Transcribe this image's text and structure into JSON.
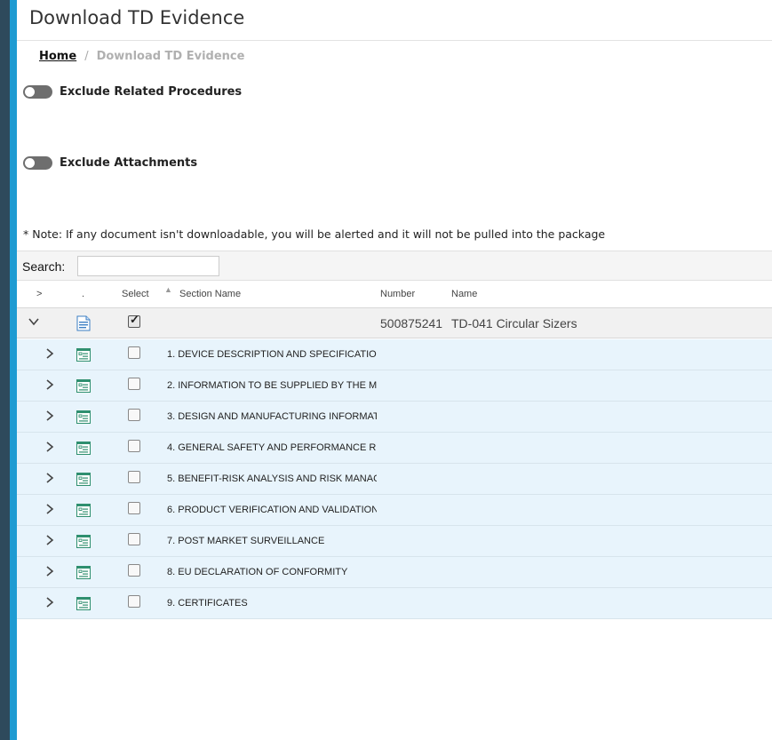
{
  "page": {
    "title": "Download TD Evidence"
  },
  "breadcrumb": {
    "home": "Home",
    "separator": "/",
    "current": "Download TD Evidence"
  },
  "toggles": [
    {
      "label": "Exclude Related Procedures",
      "on": false
    },
    {
      "label": "Exclude Attachments",
      "on": false
    }
  ],
  "note": "* Note: If any document isn't downloadable, you will be alerted and it will not be pulled into the package",
  "search": {
    "label": "Search:",
    "value": "",
    "placeholder": ""
  },
  "table": {
    "columns": {
      "expand": ">",
      "icon": ".",
      "select": "Select",
      "section_name": "Section Name",
      "number": "Number",
      "name": "Name"
    },
    "parent": {
      "number": "500875241",
      "name": "TD-041 Circular Sizers",
      "selected": true,
      "expanded": true
    },
    "sections": [
      {
        "label": "1. DEVICE DESCRIPTION AND SPECIFICATIO",
        "selected": false
      },
      {
        "label": "2. INFORMATION TO BE SUPPLIED BY THE M",
        "selected": false
      },
      {
        "label": "3. DESIGN AND MANUFACTURING INFORMAT",
        "selected": false
      },
      {
        "label": "4. GENERAL SAFETY AND PERFORMANCE R",
        "selected": false
      },
      {
        "label": "5. BENEFIT-RISK ANALYSIS AND RISK MANAC",
        "selected": false
      },
      {
        "label": "6. PRODUCT VERIFICATION AND VALIDATION",
        "selected": false
      },
      {
        "label": "7. POST MARKET SURVEILLANCE",
        "selected": false
      },
      {
        "label": "8. EU DECLARATION OF CONFORMITY",
        "selected": false
      },
      {
        "label": "9. CERTIFICATES",
        "selected": false
      }
    ]
  },
  "colors": {
    "accent_blue": "#1e9bd2",
    "sidebar_dark": "#2e4a5c",
    "child_row_bg": "#e8f4fc"
  }
}
